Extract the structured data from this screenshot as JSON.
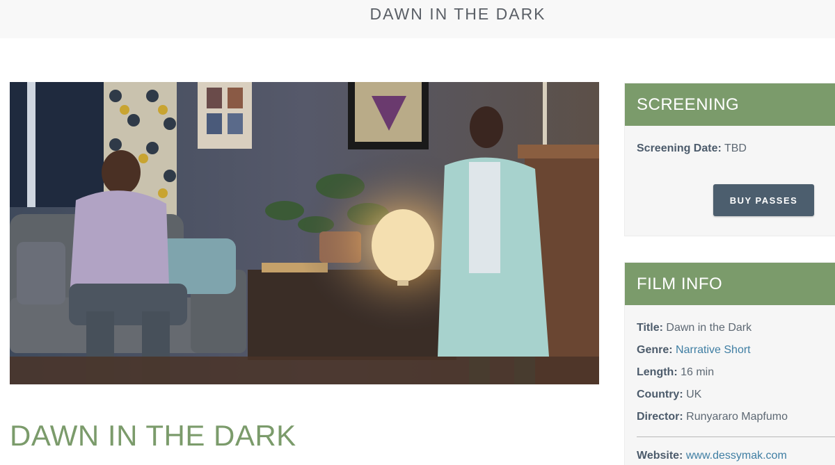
{
  "header": {
    "title": "DAWN IN THE DARK"
  },
  "main": {
    "film_heading": "DAWN IN THE DARK"
  },
  "screening": {
    "heading": "SCREENING",
    "date_label": "Screening Date:",
    "date_value": "TBD",
    "buy_label": "BUY PASSES"
  },
  "film_info": {
    "heading": "FILM INFO",
    "title_label": "Title:",
    "title_value": "Dawn in the Dark",
    "genre_label": "Genre:",
    "genre_value": "Narrative Short",
    "length_label": "Length:",
    "length_value": "16 min",
    "country_label": "Country:",
    "country_value": "UK",
    "director_label": "Director:",
    "director_value": "Runyararo Mapfumo",
    "website_label": "Website:",
    "website_value": "www.dessymak.com"
  },
  "colors": {
    "accent_green": "#7b9b6b",
    "button": "#4c5e6e",
    "link": "#3f7ea3"
  }
}
